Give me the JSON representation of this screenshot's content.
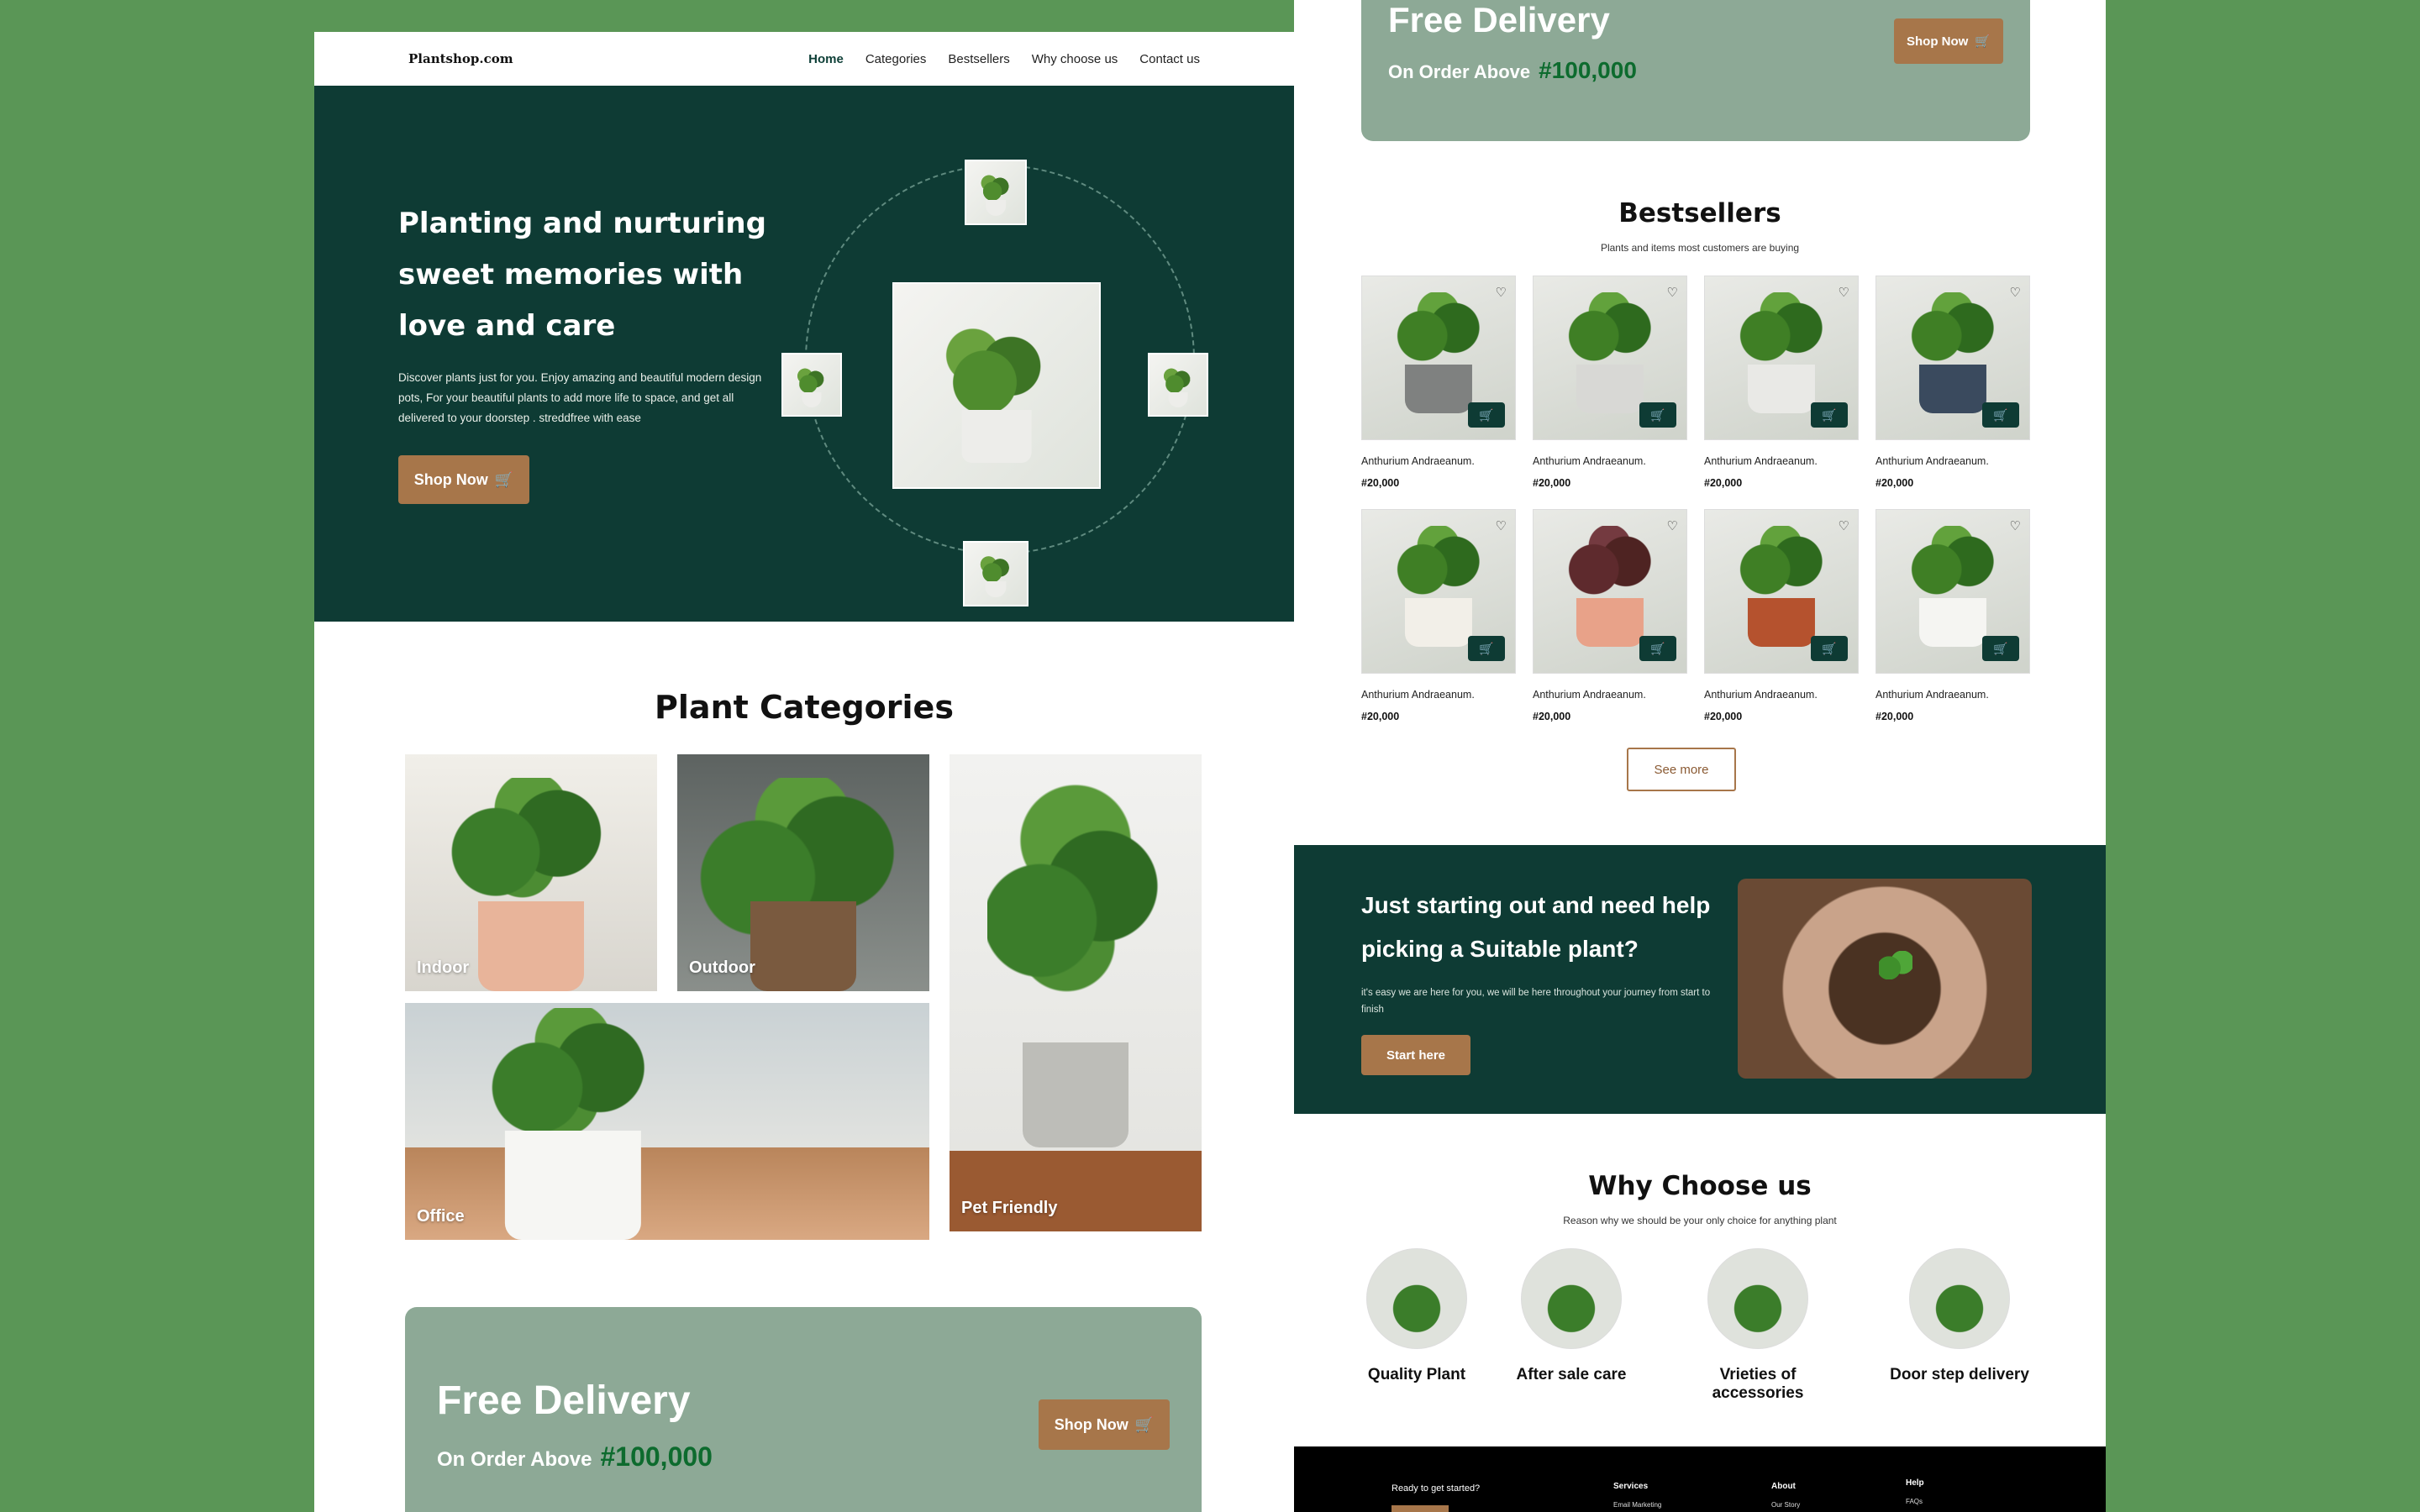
{
  "nav": {
    "brand": "Plantshop.com",
    "links": [
      "Home",
      "Categories",
      "Bestsellers",
      "Why choose us",
      "Contact us"
    ]
  },
  "hero": {
    "title": "Planting and nurturing sweet memories with love and care",
    "description": "Discover plants just for you. Enjoy amazing and beautiful modern design pots, For your beautiful plants to add more life to space, and get all delivered to your doorstep . streddfree with ease",
    "button": "Shop Now"
  },
  "categories": {
    "title": "Plant Categories",
    "items": [
      "Indoor",
      "Outdoor",
      "Office",
      "Pet Friendly"
    ]
  },
  "free_delivery": {
    "title": "Free Delivery",
    "subtitle": "On Order Above",
    "amount": "#100,000",
    "button": "Shop Now"
  },
  "bestsellers": {
    "title": "Bestsellers",
    "subtitle": "Plants and items most customers are buying",
    "products": [
      {
        "name": "Anthurium Andraeanum.",
        "price": "#20,000"
      },
      {
        "name": "Anthurium Andraeanum.",
        "price": "#20,000"
      },
      {
        "name": "Anthurium Andraeanum.",
        "price": "#20,000"
      },
      {
        "name": "Anthurium Andraeanum.",
        "price": "#20,000"
      },
      {
        "name": "Anthurium Andraeanum.",
        "price": "#20,000"
      },
      {
        "name": "Anthurium Andraeanum.",
        "price": "#20,000"
      },
      {
        "name": "Anthurium Andraeanum.",
        "price": "#20,000"
      },
      {
        "name": "Anthurium Andraeanum.",
        "price": "#20,000"
      }
    ],
    "see_more": "See more"
  },
  "cta": {
    "title": "Just starting out and need help picking a Suitable  plant?",
    "description": "it's easy we are here for you, we will be here throughout your journey from start to finish",
    "button": "Start here"
  },
  "why": {
    "title": "Why Choose us",
    "subtitle": "Reason why we should be your only choice for anything plant",
    "items": [
      "Quality Plant",
      "After sale care",
      "Vrieties of accessories",
      "Door step delivery"
    ]
  },
  "footer": {
    "ready": "Ready to get started?",
    "services": "Services",
    "services_sub": "Email Marketing",
    "about": "About",
    "about_sub": "Our Story",
    "help": "Help",
    "help_sub": "FAQs"
  },
  "colors": {
    "background": "#5a9656",
    "dark_green": "#0e3b34",
    "brown_accent": "#a7764a",
    "sage": "#8da996",
    "price_green": "#0d6b2e"
  }
}
